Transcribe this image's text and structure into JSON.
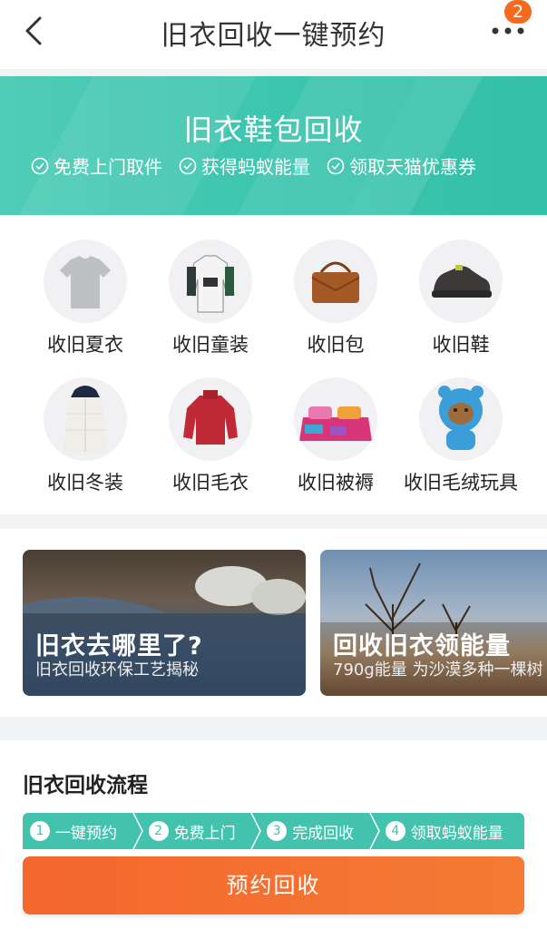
{
  "header": {
    "title": "旧衣回收一键预约",
    "badge_count": "2",
    "back_icon": "chevron-left-icon",
    "more_icon": "more-dots-icon"
  },
  "banner": {
    "title": "旧衣鞋包回收",
    "perks": [
      "免费上门取件",
      "获得蚂蚁能量",
      "领取天猫优惠券"
    ]
  },
  "categories": [
    {
      "label": "收旧夏衣",
      "icon": "tshirt-icon"
    },
    {
      "label": "收旧童装",
      "icon": "kids-hoodie-icon"
    },
    {
      "label": "收旧包",
      "icon": "handbag-icon"
    },
    {
      "label": "收旧鞋",
      "icon": "shoe-icon"
    },
    {
      "label": "收旧冬装",
      "icon": "down-jacket-icon"
    },
    {
      "label": "收旧毛衣",
      "icon": "sweater-icon"
    },
    {
      "label": "收旧被褥",
      "icon": "bedding-icon"
    },
    {
      "label": "收旧毛绒玩具",
      "icon": "plush-toy-icon"
    }
  ],
  "cards": [
    {
      "title": "旧衣去哪里了?",
      "subtitle": "旧衣回收环保工艺揭秘"
    },
    {
      "title": "回收旧衣领能量",
      "subtitle": "790g能量 为沙漠多种一棵树"
    }
  ],
  "process": {
    "title": "旧衣回收流程",
    "steps": [
      {
        "num": "1",
        "label": "一键预约"
      },
      {
        "num": "2",
        "label": "免费上门"
      },
      {
        "num": "3",
        "label": "完成回收"
      },
      {
        "num": "4",
        "label": "领取蚂蚁能量"
      }
    ]
  },
  "cta": {
    "label": "预约回收"
  },
  "colors": {
    "accent_green": "#43c3ad",
    "accent_orange": "#f4672d"
  }
}
